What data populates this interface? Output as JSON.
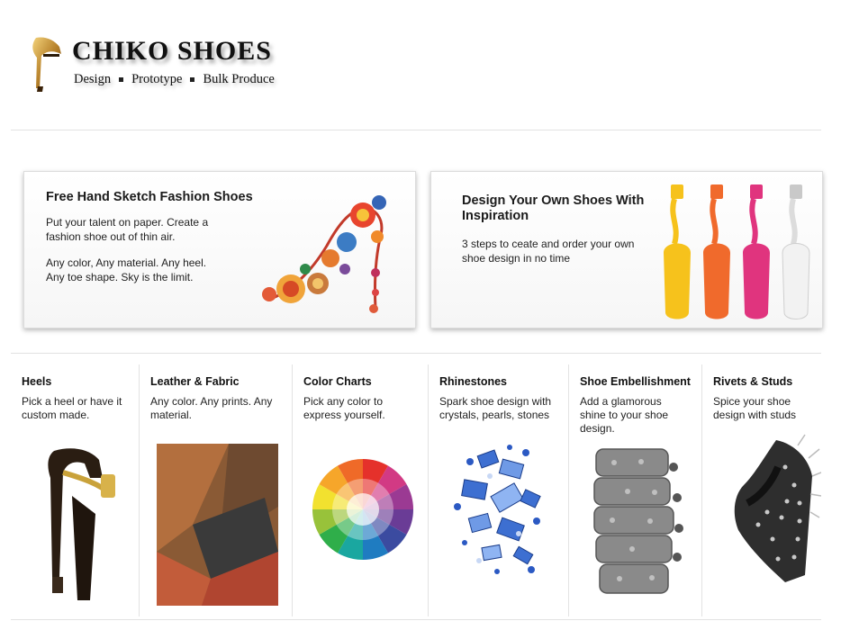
{
  "brand": {
    "name": "CHIKO SHOES",
    "tagline_items": [
      "Design",
      "Prototype",
      "Bulk Produce"
    ]
  },
  "banners": [
    {
      "title": "Free Hand Sketch Fashion Shoes",
      "paragraphs": [
        "Put your talent on paper. Create a fashion shoe out of thin air.",
        "Any color, Any material. Any heel. Any toe shape. Sky is the limit."
      ],
      "image": "floral-high-heel-illustration"
    },
    {
      "title": "Design Your Own Shoes With Inspiration",
      "paragraphs": [
        "3 steps to ceate  and order your own shoe design in no time"
      ],
      "image": "paint-dipped-loafers",
      "colors": [
        "#f6c21c",
        "#f06a2c",
        "#e0347e",
        "#eeeeee"
      ]
    }
  ],
  "categories": [
    {
      "title": "Heels",
      "desc": "Pick a heel or have it custom made.",
      "image": "black-gold-heel-sandal"
    },
    {
      "title": "Leather & Fabric",
      "desc": "Any color. Any prints. Any material.",
      "image": "leather-swatches"
    },
    {
      "title": "Color Charts",
      "desc": "Pick any color to express yourself.",
      "image": "color-wheel"
    },
    {
      "title": "Rhinestones",
      "desc": "Spark shoe design with crystals, pearls, stones",
      "image": "blue-rhinestones"
    },
    {
      "title": "Shoe Embellishment",
      "desc": "Add a glamorous shine to your shoe design.",
      "image": "crystal-cuff-embellishment"
    },
    {
      "title": "Rivets & Studs",
      "desc": "Spice your shoe design with studs",
      "image": "studded-wedge-shoe"
    }
  ]
}
